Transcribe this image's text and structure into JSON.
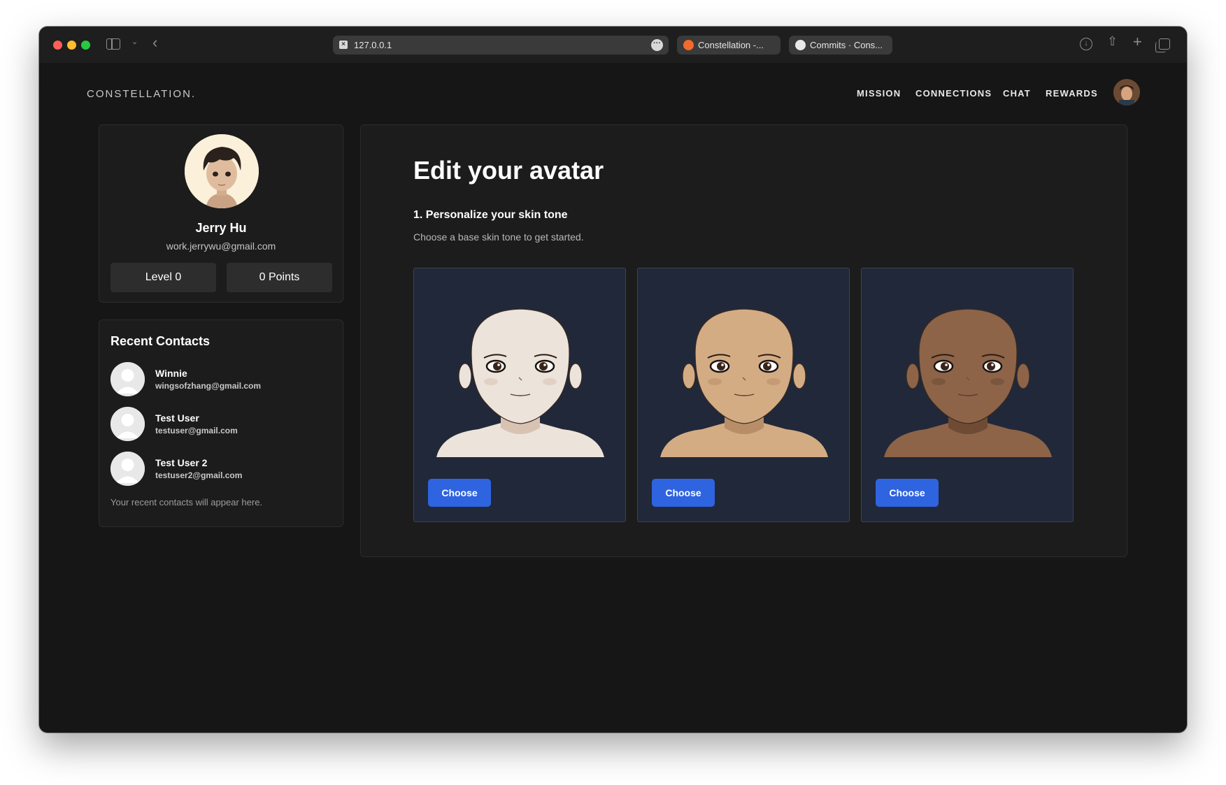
{
  "browser": {
    "url": "127.0.0.1",
    "tabs": [
      {
        "title": "Constellation -...",
        "icon": "fire-icon"
      },
      {
        "title": "Commits · Cons...",
        "icon": "github-icon"
      }
    ]
  },
  "nav": {
    "brand": "CONSTELLATION.",
    "items": [
      "MISSION",
      "CONNECTIONS",
      "CHAT",
      "REWARDS"
    ]
  },
  "profile": {
    "name": "Jerry Hu",
    "email": "work.jerrywu@gmail.com",
    "level": "Level 0",
    "points": "0 Points"
  },
  "contacts": {
    "title": "Recent Contacts",
    "items": [
      {
        "name": "Winnie",
        "email": "wingsofzhang@gmail.com"
      },
      {
        "name": "Test User",
        "email": "testuser@gmail.com"
      },
      {
        "name": "Test User 2",
        "email": "testuser2@gmail.com"
      }
    ],
    "note": "Your recent contacts will appear here."
  },
  "editor": {
    "title": "Edit your avatar",
    "step_title": "1. Personalize your skin tone",
    "step_subtitle": "Choose a base skin tone to get started.",
    "tones": [
      {
        "skin": "#ece3da",
        "shade": "#d8c3b3",
        "button": "Choose"
      },
      {
        "skin": "#d4ac84",
        "shade": "#b88e68",
        "button": "Choose"
      },
      {
        "skin": "#8d6448",
        "shade": "#6f4b33",
        "button": "Choose"
      }
    ]
  },
  "colors": {
    "accent": "#2f64e0",
    "background": "#161616",
    "card": "#1c1c1c",
    "tone_card": "#212839"
  }
}
